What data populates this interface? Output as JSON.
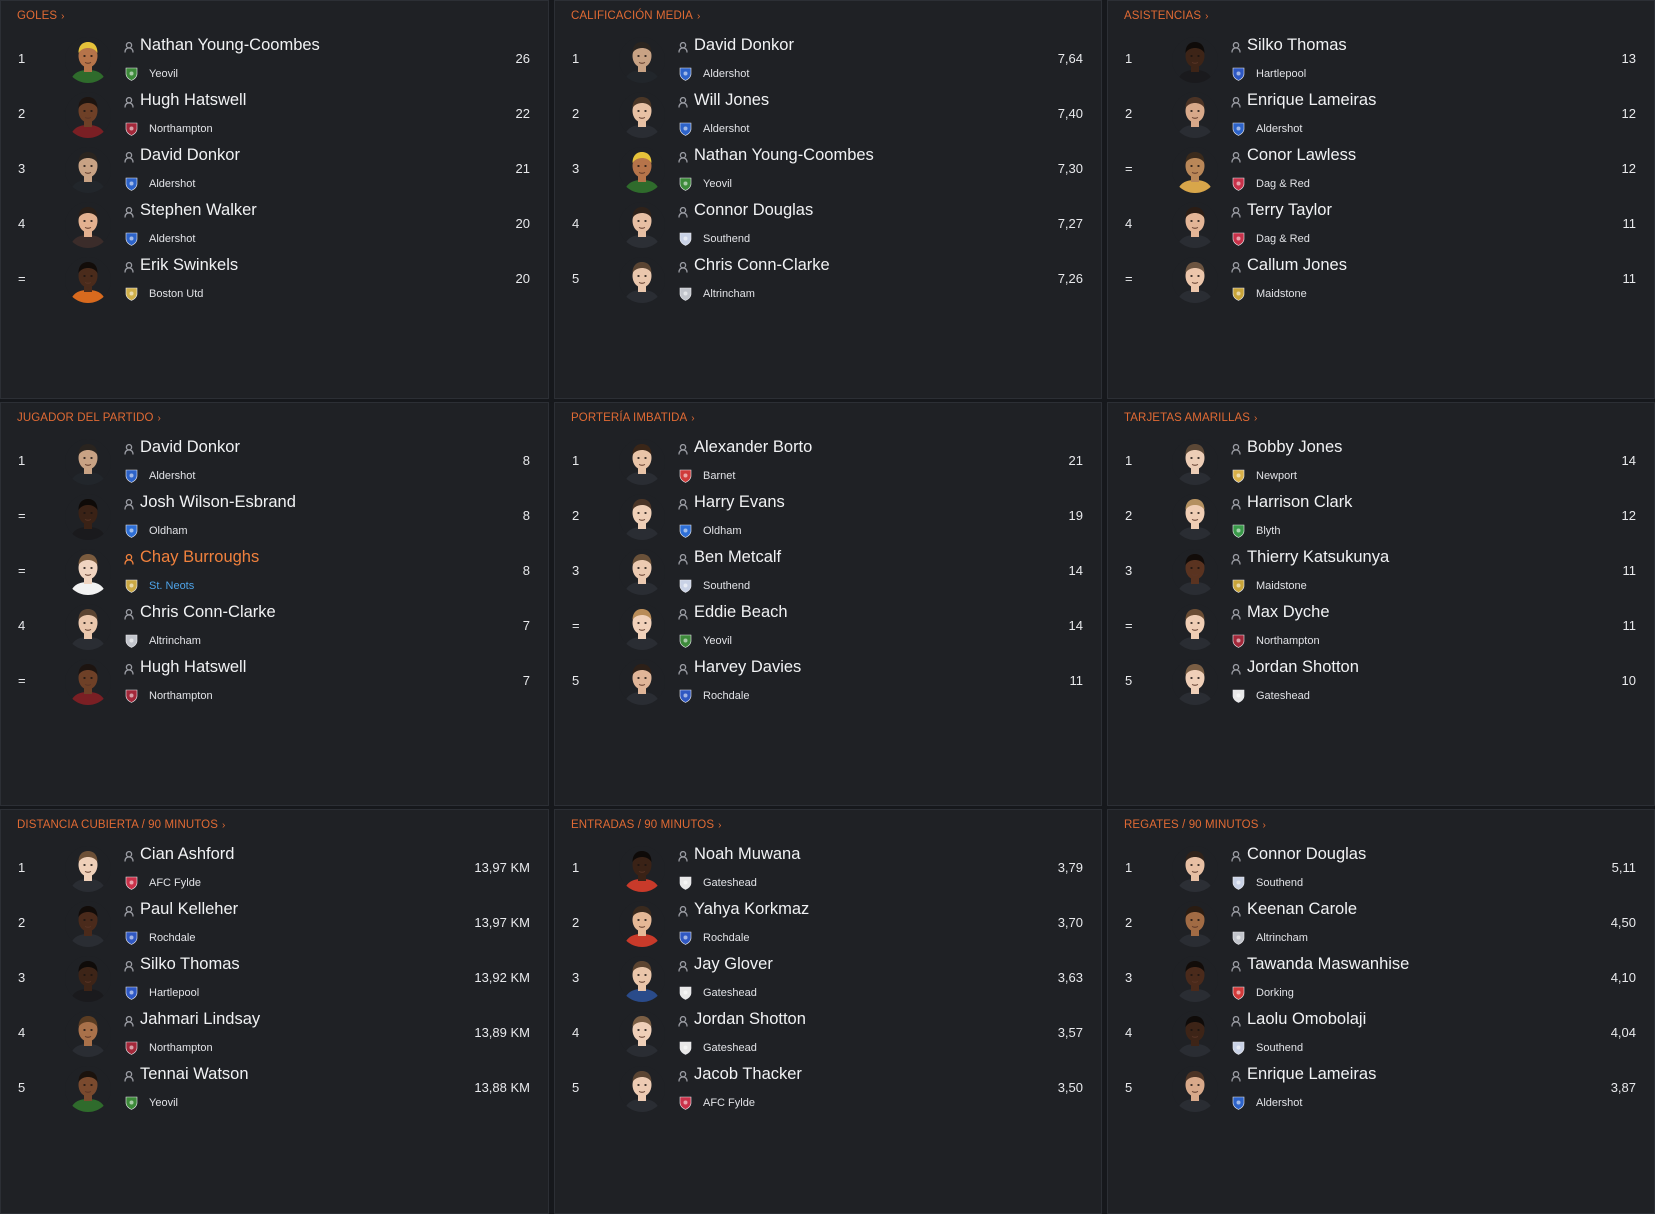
{
  "panels": [
    {
      "title": "GOLES",
      "rows": [
        {
          "rank": "1",
          "name": "Nathan Young-Coombes",
          "club": "Yeovil",
          "value": "26",
          "skin": "#b6744a",
          "hair": "#e6c23a",
          "shirt": "#2f6b2c",
          "badge": "#3d8a3a"
        },
        {
          "rank": "2",
          "name": "Hugh Hatswell",
          "club": "Northampton",
          "value": "22",
          "skin": "#6e4027",
          "hair": "#1d1410",
          "shirt": "#7a1f24",
          "badge": "#a3283a"
        },
        {
          "rank": "3",
          "name": "David Donkor",
          "club": "Aldershot",
          "value": "21",
          "skin": "#c8a284",
          "hair": "#2a241f",
          "shirt": "#22262b",
          "badge": "#2d63c9"
        },
        {
          "rank": "4",
          "name": "Stephen Walker",
          "club": "Aldershot",
          "value": "20",
          "skin": "#e3b190",
          "hair": "#2a1f18",
          "shirt": "#3b2c2a",
          "badge": "#2d63c9"
        },
        {
          "rank": "=",
          "name": "Erik Swinkels",
          "club": "Boston Utd",
          "value": "20",
          "skin": "#4a2b1b",
          "hair": "#120c09",
          "shirt": "#d86a1e",
          "badge": "#d0b04a"
        }
      ]
    },
    {
      "title": "CALIFICACIÓN MEDIA",
      "rows": [
        {
          "rank": "1",
          "name": "David Donkor",
          "club": "Aldershot",
          "value": "7,64",
          "skin": "#c8a284",
          "hair": "#2a241f",
          "shirt": "#22262b",
          "badge": "#2d63c9"
        },
        {
          "rank": "2",
          "name": "Will Jones",
          "club": "Aldershot",
          "value": "7,40",
          "skin": "#e8c1a4",
          "hair": "#4a3626",
          "shirt": "#2a2d33",
          "badge": "#2d63c9"
        },
        {
          "rank": "3",
          "name": "Nathan Young-Coombes",
          "club": "Yeovil",
          "value": "7,30",
          "skin": "#b6744a",
          "hair": "#e6c23a",
          "shirt": "#2f6b2c",
          "badge": "#3d8a3a"
        },
        {
          "rank": "4",
          "name": "Connor Douglas",
          "club": "Southend",
          "value": "7,27",
          "skin": "#e7bfa3",
          "hair": "#2f221a",
          "shirt": "#2c2f35",
          "badge": "#c9d2e6"
        },
        {
          "rank": "5",
          "name": "Chris Conn-Clarke",
          "club": "Altrincham",
          "value": "7,26",
          "skin": "#eac7ad",
          "hair": "#5a4432",
          "shirt": "#2a2d33",
          "badge": "#c2c5cc"
        }
      ]
    },
    {
      "title": "ASISTENCIAS",
      "rows": [
        {
          "rank": "1",
          "name": "Silko Thomas",
          "club": "Hartlepool",
          "value": "13",
          "skin": "#3d2417",
          "hair": "#0f0b09",
          "shirt": "#1a1a1d",
          "badge": "#2e58c4"
        },
        {
          "rank": "2",
          "name": "Enrique Lameiras",
          "club": "Aldershot",
          "value": "12",
          "skin": "#d8a98a",
          "hair": "#4b3325",
          "shirt": "#2a2d33",
          "badge": "#2d63c9"
        },
        {
          "rank": "=",
          "name": "Conor Lawless",
          "club": "Dag & Red",
          "value": "12",
          "skin": "#b98758",
          "hair": "#3a2a1c",
          "shirt": "#d8a64a",
          "badge": "#c8324a"
        },
        {
          "rank": "4",
          "name": "Terry Taylor",
          "club": "Dag & Red",
          "value": "11",
          "skin": "#e3b596",
          "hair": "#2b1d15",
          "shirt": "#2a2d33",
          "badge": "#c8324a"
        },
        {
          "rank": "=",
          "name": "Callum Jones",
          "club": "Maidstone",
          "value": "11",
          "skin": "#ecc6ab",
          "hair": "#6c5440",
          "shirt": "#2a2d33",
          "badge": "#c9a53a"
        }
      ]
    },
    {
      "title": "JUGADOR DEL PARTIDO",
      "rows": [
        {
          "rank": "1",
          "name": "David Donkor",
          "club": "Aldershot",
          "value": "8",
          "skin": "#c8a284",
          "hair": "#2a241f",
          "shirt": "#22262b",
          "badge": "#2d63c9",
          "hl": false
        },
        {
          "rank": "=",
          "name": "Josh Wilson-Esbrand",
          "club": "Oldham",
          "value": "8",
          "skin": "#3a2216",
          "hair": "#0e0a08",
          "shirt": "#1a1a1d",
          "badge": "#2e6fd6",
          "hl": false
        },
        {
          "rank": "=",
          "name": "Chay Burroughs",
          "club": "St. Neots",
          "value": "8",
          "skin": "#f0d4c0",
          "hair": "#7a5b3e",
          "shirt": "#f2f2f2",
          "badge": "#caa844",
          "hl": true
        },
        {
          "rank": "4",
          "name": "Chris Conn-Clarke",
          "club": "Altrincham",
          "value": "7",
          "skin": "#eac7ad",
          "hair": "#5a4432",
          "shirt": "#2a2d33",
          "badge": "#c2c5cc",
          "hl": false
        },
        {
          "rank": "=",
          "name": "Hugh Hatswell",
          "club": "Northampton",
          "value": "7",
          "skin": "#6e4027",
          "hair": "#1d1410",
          "shirt": "#7a1f24",
          "badge": "#a3283a",
          "hl": false
        }
      ]
    },
    {
      "title": "PORTERÍA IMBATIDA",
      "rows": [
        {
          "rank": "1",
          "name": "Alexander Borto",
          "club": "Barnet",
          "value": "21",
          "skin": "#e9c4a8",
          "hair": "#3a2618",
          "shirt": "#2a2d33",
          "badge": "#cf3b3b"
        },
        {
          "rank": "2",
          "name": "Harry Evans",
          "club": "Oldham",
          "value": "19",
          "skin": "#efcfb7",
          "hair": "#4a3527",
          "shirt": "#2a2d33",
          "badge": "#2e6fd6"
        },
        {
          "rank": "3",
          "name": "Ben Metcalf",
          "club": "Southend",
          "value": "14",
          "skin": "#eccab1",
          "hair": "#6a5139",
          "shirt": "#2a2d33",
          "badge": "#c9d2e6"
        },
        {
          "rank": "=",
          "name": "Eddie Beach",
          "club": "Yeovil",
          "value": "14",
          "skin": "#f1d1ba",
          "hair": "#b98c58",
          "shirt": "#2a2d33",
          "badge": "#3d8a3a"
        },
        {
          "rank": "5",
          "name": "Harvey Davies",
          "club": "Rochdale",
          "value": "11",
          "skin": "#e0b598",
          "hair": "#2d2018",
          "shirt": "#2a2d33",
          "badge": "#3058c2"
        }
      ]
    },
    {
      "title": "TARJETAS AMARILLAS",
      "rows": [
        {
          "rank": "1",
          "name": "Bobby Jones",
          "club": "Newport",
          "value": "14",
          "skin": "#eccdb6",
          "hair": "#5c4836",
          "shirt": "#2a2d33",
          "badge": "#d9b14a"
        },
        {
          "rank": "2",
          "name": "Harrison Clark",
          "club": "Blyth",
          "value": "12",
          "skin": "#efcdb4",
          "hair": "#b49060",
          "shirt": "#2a2d33",
          "badge": "#3a9a4a"
        },
        {
          "rank": "3",
          "name": "Thierry Katsukunya",
          "club": "Maidstone",
          "value": "11",
          "skin": "#5a3320",
          "hair": "#120c09",
          "shirt": "#2a2d33",
          "badge": "#c9a53a"
        },
        {
          "rank": "=",
          "name": "Max Dyche",
          "club": "Northampton",
          "value": "11",
          "skin": "#efcdb4",
          "hair": "#6a4c33",
          "shirt": "#2a2d33",
          "badge": "#a3283a"
        },
        {
          "rank": "5",
          "name": "Jordan Shotton",
          "club": "Gateshead",
          "value": "10",
          "skin": "#efcfb8",
          "hair": "#7a5e44",
          "shirt": "#2a2d33",
          "badge": "#e8e8e8"
        }
      ]
    },
    {
      "title": "DISTANCIA CUBIERTA / 90 MINUTOS",
      "rows": [
        {
          "rank": "1",
          "name": "Cian Ashford",
          "club": "AFC Fylde",
          "value": "13,97 KM",
          "skin": "#efd0b9",
          "hair": "#6d5037",
          "shirt": "#2a2d33",
          "badge": "#c9324a"
        },
        {
          "rank": "2",
          "name": "Paul Kelleher",
          "club": "Rochdale",
          "value": "13,97 KM",
          "skin": "#4a2a1b",
          "hair": "#120c09",
          "shirt": "#2a2d33",
          "badge": "#3058c2"
        },
        {
          "rank": "3",
          "name": "Silko Thomas",
          "club": "Hartlepool",
          "value": "13,92 KM",
          "skin": "#3d2417",
          "hair": "#0f0b09",
          "shirt": "#1a1a1d",
          "badge": "#2e58c4"
        },
        {
          "rank": "4",
          "name": "Jahmari Lindsay",
          "club": "Northampton",
          "value": "13,89 KM",
          "skin": "#a9714a",
          "hair": "#5a3c22",
          "shirt": "#2a2d33",
          "badge": "#a3283a"
        },
        {
          "rank": "5",
          "name": "Tennai Watson",
          "club": "Yeovil",
          "value": "13,88 KM",
          "skin": "#7a4a2e",
          "hair": "#1a120d",
          "shirt": "#2f6b2c",
          "badge": "#3d8a3a"
        }
      ]
    },
    {
      "title": "ENTRADAS / 90 MINUTOS",
      "rows": [
        {
          "rank": "1",
          "name": "Noah Muwana",
          "club": "Gateshead",
          "value": "3,79",
          "skin": "#3a2216",
          "hair": "#0e0a08",
          "shirt": "#c83a2a",
          "badge": "#e8e8e8"
        },
        {
          "rank": "2",
          "name": "Yahya Korkmaz",
          "club": "Rochdale",
          "value": "3,70",
          "skin": "#e5b896",
          "hair": "#3a2a1e",
          "shirt": "#c83a2a",
          "badge": "#3058c2"
        },
        {
          "rank": "3",
          "name": "Jay Glover",
          "club": "Gateshead",
          "value": "3,63",
          "skin": "#eac6aa",
          "hair": "#5c4430",
          "shirt": "#2a4b8a",
          "badge": "#e8e8e8"
        },
        {
          "rank": "4",
          "name": "Jordan Shotton",
          "club": "Gateshead",
          "value": "3,57",
          "skin": "#efcfb8",
          "hair": "#7a5e44",
          "shirt": "#2a2d33",
          "badge": "#e8e8e8"
        },
        {
          "rank": "5",
          "name": "Jacob Thacker",
          "club": "AFC Fylde",
          "value": "3,50",
          "skin": "#edcbb3",
          "hair": "#5a4432",
          "shirt": "#2a2d33",
          "badge": "#c9324a"
        }
      ]
    },
    {
      "title": "REGATES / 90 MINUTOS",
      "rows": [
        {
          "rank": "1",
          "name": "Connor Douglas",
          "club": "Southend",
          "value": "5,11",
          "skin": "#e7bfa3",
          "hair": "#2f221a",
          "shirt": "#2c2f35",
          "badge": "#c9d2e6"
        },
        {
          "rank": "2",
          "name": "Keenan Carole",
          "club": "Altrincham",
          "value": "4,50",
          "skin": "#a16b44",
          "hair": "#2a1c12",
          "shirt": "#2a2d33",
          "badge": "#c2c5cc"
        },
        {
          "rank": "3",
          "name": "Tawanda Maswanhise",
          "club": "Dorking",
          "value": "4,10",
          "skin": "#4a2a1b",
          "hair": "#120c09",
          "shirt": "#2a2d33",
          "badge": "#d23a3a"
        },
        {
          "rank": "4",
          "name": "Laolu Omobolaji",
          "club": "Southend",
          "value": "4,04",
          "skin": "#3d2417",
          "hair": "#0f0b09",
          "shirt": "#2a2d33",
          "badge": "#c9d2e6"
        },
        {
          "rank": "5",
          "name": "Enrique Lameiras",
          "club": "Aldershot",
          "value": "3,87",
          "skin": "#d8a98a",
          "hair": "#4b3325",
          "shirt": "#2a2d33",
          "badge": "#2d63c9"
        }
      ]
    }
  ],
  "colors": {
    "accent": "#e06a34",
    "highlight_name": "#f0813d",
    "highlight_club": "#4ea3e8"
  }
}
